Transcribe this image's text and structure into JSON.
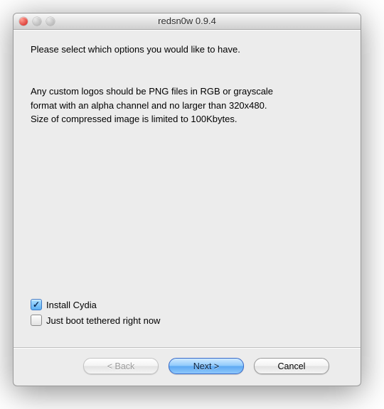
{
  "window": {
    "title": "redsn0w 0.9.4"
  },
  "content": {
    "prompt": "Please select which options you would like to have.",
    "info_line1": "Any custom logos should be PNG files in RGB or grayscale",
    "info_line2": "format with an alpha channel and no larger than 320x480.",
    "info_line3": "Size of compressed image is limited to 100Kbytes."
  },
  "options": {
    "install_cydia": {
      "label": "Install Cydia",
      "checked": true
    },
    "boot_tethered": {
      "label": "Just boot tethered right now",
      "checked": false
    }
  },
  "buttons": {
    "back_label": "< Back",
    "next_label": "Next >",
    "cancel_label": "Cancel"
  }
}
